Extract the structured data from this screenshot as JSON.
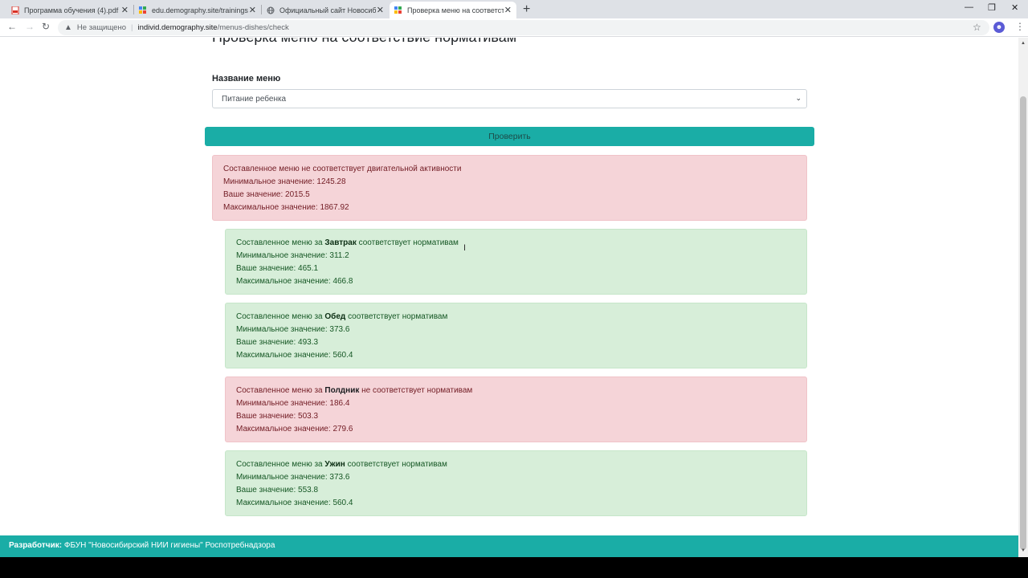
{
  "tabs": [
    {
      "title": "Программа обучения (4).pdf"
    },
    {
      "title": "edu.demography.site/trainings/c"
    },
    {
      "title": "Официальный сайт Новосибир"
    },
    {
      "title": "Проверка меню на соответств"
    }
  ],
  "address": {
    "security": "Не защищено",
    "host": "individ.demography.site",
    "path": "/menus-dishes/check"
  },
  "page": {
    "title": "Проверка меню на соответствие нормативам",
    "menu_label": "Название меню",
    "menu_value": "Питание ребенка",
    "check_button": "Проверить"
  },
  "labels": {
    "min": "Минимальное значение:",
    "yours": "Ваше значение:",
    "max": "Максимальное значение:",
    "prefix": "Составленное меню за",
    "ok": "соответствует нормативам",
    "fail": "не соответствует нормативам"
  },
  "overall": {
    "message": "Составленное меню не соответствует двигательной активности",
    "min": "1245.28",
    "yours": "2015.5",
    "max": "1867.92"
  },
  "meals": [
    {
      "name": "Завтрак",
      "min": "311.2",
      "yours": "465.1",
      "max": "466.8"
    },
    {
      "name": "Обед",
      "min": "373.6",
      "yours": "493.3",
      "max": "560.4"
    },
    {
      "name": "Полдник",
      "min": "186.4",
      "yours": "503.3",
      "max": "279.6"
    },
    {
      "name": "Ужин",
      "min": "373.6",
      "yours": "553.8",
      "max": "560.4"
    }
  ],
  "footer": {
    "label": "Разработчик:",
    "text": "ФБУН \"Новосибирский НИИ гигиены\" Роспотребнадзора"
  },
  "colors": {
    "accent": "#1aada6",
    "danger_bg": "#f5d4d8",
    "success_bg": "#d7eed9"
  }
}
